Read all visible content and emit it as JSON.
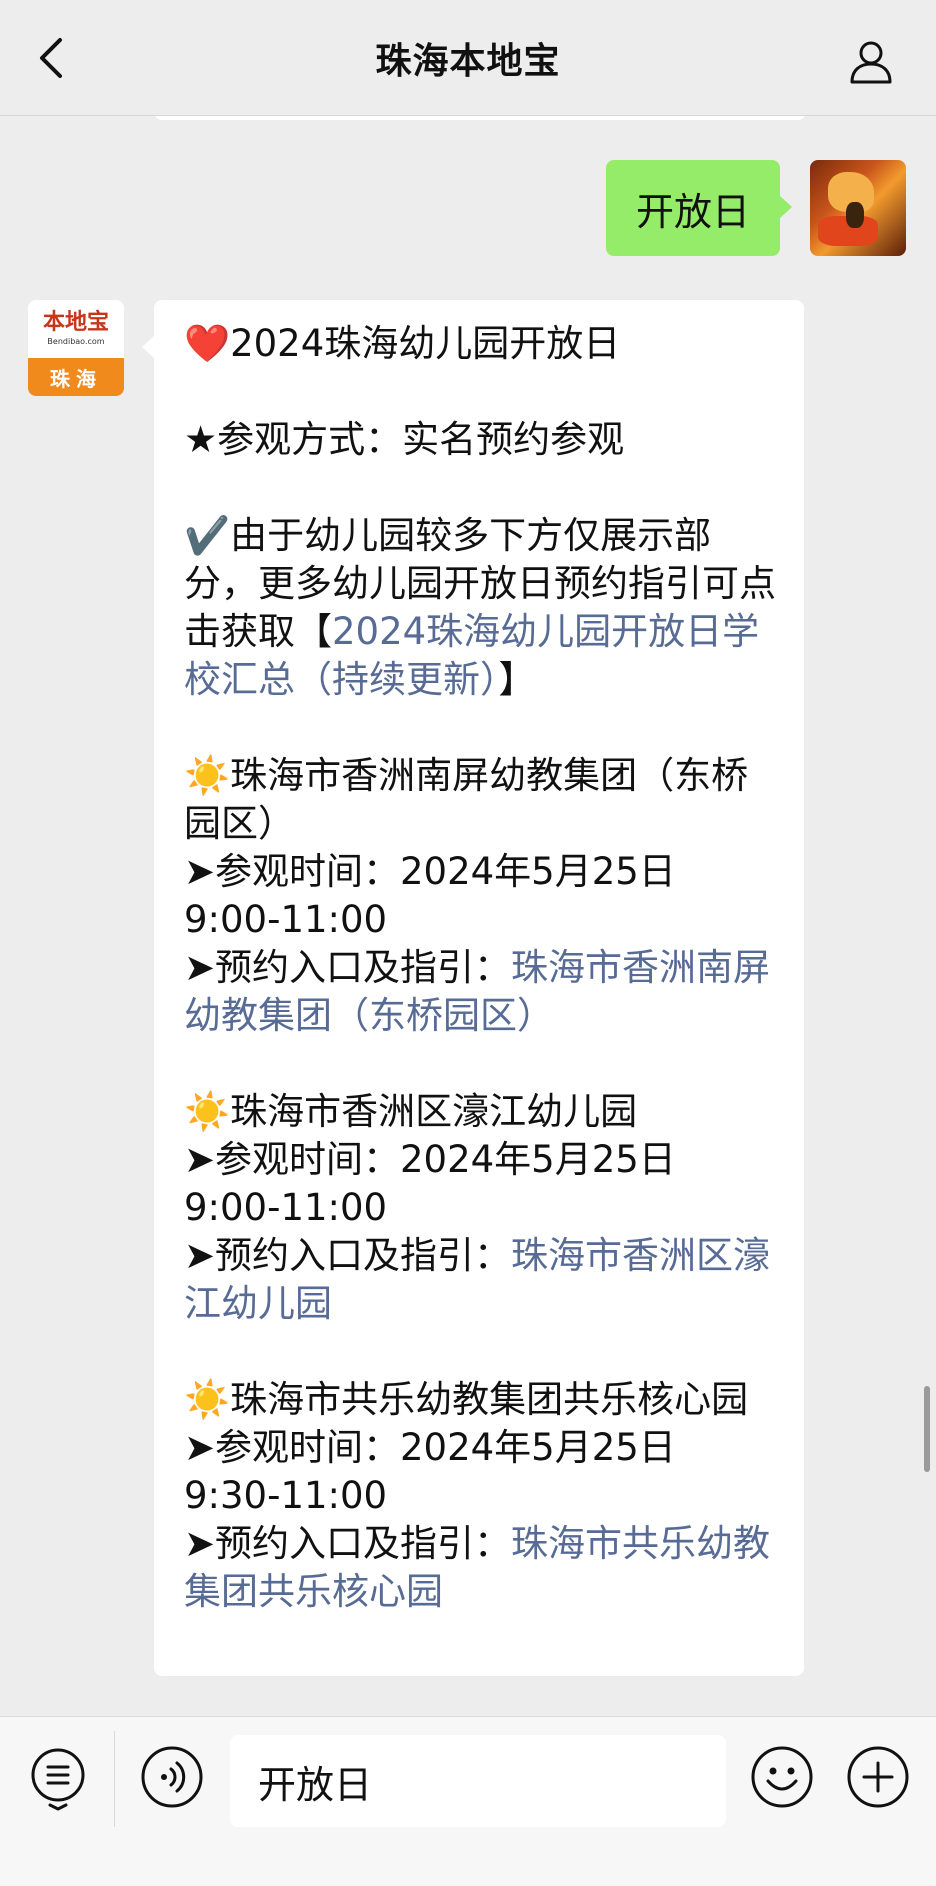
{
  "header": {
    "title": "珠海本地宝"
  },
  "my_message": {
    "text": "开放日"
  },
  "account": {
    "logo_brand": "本地宝",
    "logo_sub": "Bendibao.com",
    "logo_city": "珠海"
  },
  "article": {
    "heading_icon": "❤️",
    "heading": "2024珠海幼儿园开放日",
    "method": "★参观方式：实名预约参观",
    "note_icon": "✔️",
    "note_text": "由于幼儿园较多下方仅展示部分，更多幼儿园开放日预约指引可点击获取【",
    "note_link": "2024珠海幼儿园开放日学校汇总（持续更新）",
    "note_end": "】",
    "schools": [
      {
        "icon": "☀️",
        "name": "珠海市香洲南屏幼教集团（东桥园区）",
        "time_label": "➤参观时间：",
        "time": "2024年5月25日 9:00-11:00",
        "entry_label": "➤预约入口及指引：",
        "entry_link": "珠海市香洲南屏幼教集团（东桥园区）"
      },
      {
        "icon": "☀️",
        "name": "珠海市香洲区濠江幼儿园",
        "time_label": "➤参观时间：",
        "time": "2024年5月25日 9:00-11:00",
        "entry_label": "➤预约入口及指引：",
        "entry_link": "珠海市香洲区濠江幼儿园"
      },
      {
        "icon": "☀️",
        "name": "珠海市共乐幼教集团共乐核心园",
        "time_label": "➤参观时间：",
        "time": "2024年5月25日 9:30-11:00",
        "entry_label": "➤预约入口及指引：",
        "entry_link": "珠海市共乐幼教集团共乐核心园"
      }
    ]
  },
  "input": {
    "value": "开放日"
  },
  "icons": {
    "back": "chevron-left-icon",
    "profile": "user-icon",
    "menu": "list-menu-icon",
    "voice": "voice-icon",
    "emoji": "smiley-icon",
    "plus": "plus-icon"
  },
  "colors": {
    "bubble_mine": "#95ec69",
    "link": "#576b95",
    "background": "#ededed"
  }
}
